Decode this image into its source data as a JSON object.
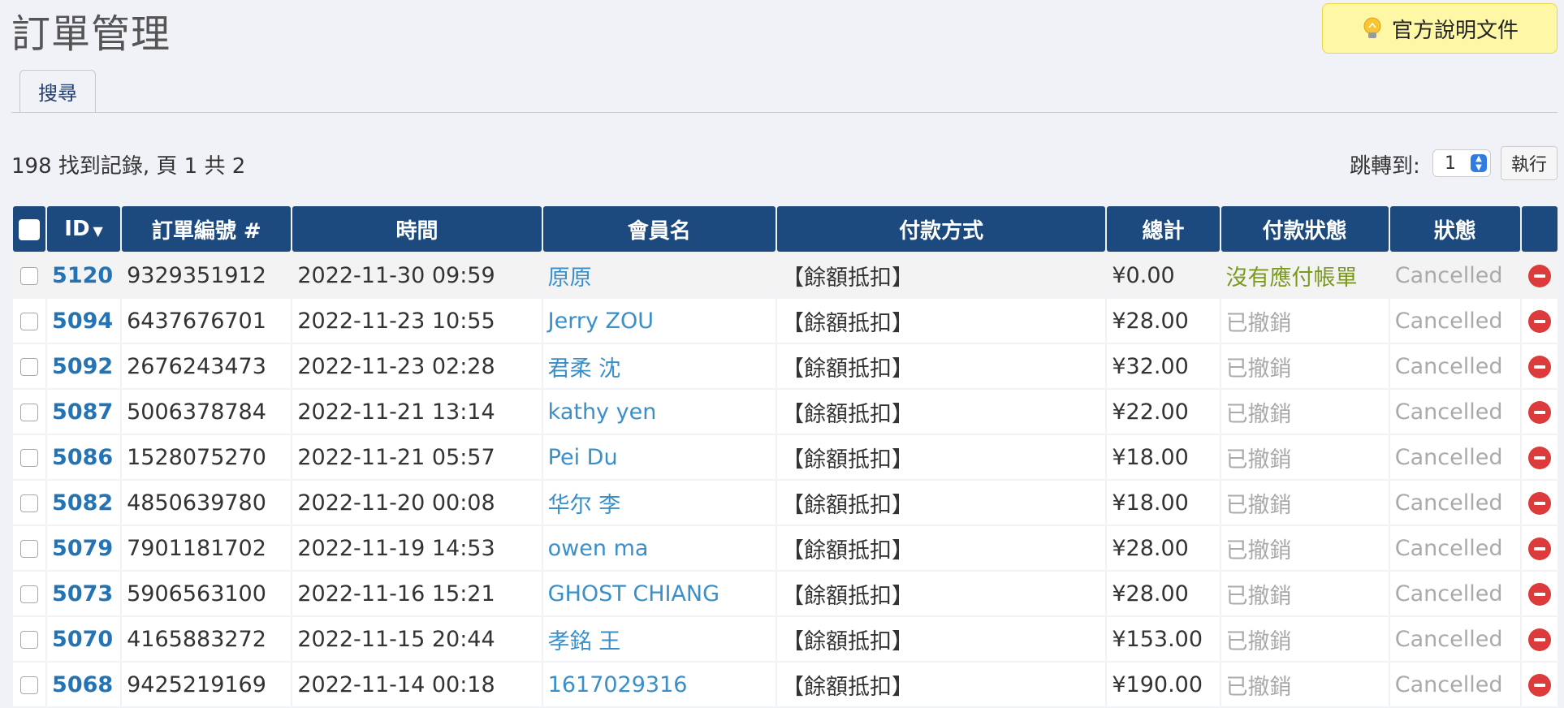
{
  "page": {
    "title": "訂單管理",
    "docs_button": "官方說明文件"
  },
  "tabs": [
    {
      "label": "搜尋"
    }
  ],
  "pagination": {
    "records_info": "198 找到記錄, 頁 1 共 2",
    "goto_label": "跳轉到:",
    "goto_value": "1",
    "goto_button": "執行"
  },
  "table": {
    "headers": {
      "id": "ID",
      "order_no": "訂單編號 #",
      "time": "時間",
      "member": "會員名",
      "payment": "付款方式",
      "total": "總計",
      "pay_status": "付款狀態",
      "status": "狀態"
    },
    "rows": [
      {
        "id": "5120",
        "order_no": "9329351912",
        "time": "2022-11-30 09:59",
        "member": "原原",
        "payment": "【餘額抵扣】",
        "total": "¥0.00",
        "pay_status": "沒有應付帳單",
        "status": "Cancelled"
      },
      {
        "id": "5094",
        "order_no": "6437676701",
        "time": "2022-11-23 10:55",
        "member": "Jerry ZOU",
        "payment": "【餘額抵扣】",
        "total": "¥28.00",
        "pay_status": "已撤銷",
        "status": "Cancelled"
      },
      {
        "id": "5092",
        "order_no": "2676243473",
        "time": "2022-11-23 02:28",
        "member": "君柔 沈",
        "payment": "【餘額抵扣】",
        "total": "¥32.00",
        "pay_status": "已撤銷",
        "status": "Cancelled"
      },
      {
        "id": "5087",
        "order_no": "5006378784",
        "time": "2022-11-21 13:14",
        "member": "kathy yen",
        "payment": "【餘額抵扣】",
        "total": "¥22.00",
        "pay_status": "已撤銷",
        "status": "Cancelled"
      },
      {
        "id": "5086",
        "order_no": "1528075270",
        "time": "2022-11-21 05:57",
        "member": "Pei Du",
        "payment": "【餘額抵扣】",
        "total": "¥18.00",
        "pay_status": "已撤銷",
        "status": "Cancelled"
      },
      {
        "id": "5082",
        "order_no": "4850639780",
        "time": "2022-11-20 00:08",
        "member": "华尔 李",
        "payment": "【餘額抵扣】",
        "total": "¥18.00",
        "pay_status": "已撤銷",
        "status": "Cancelled"
      },
      {
        "id": "5079",
        "order_no": "7901181702",
        "time": "2022-11-19 14:53",
        "member": "owen ma",
        "payment": "【餘額抵扣】",
        "total": "¥28.00",
        "pay_status": "已撤銷",
        "status": "Cancelled"
      },
      {
        "id": "5073",
        "order_no": "5906563100",
        "time": "2022-11-16 15:21",
        "member": "GHOST CHIANG",
        "payment": "【餘額抵扣】",
        "total": "¥28.00",
        "pay_status": "已撤銷",
        "status": "Cancelled"
      },
      {
        "id": "5070",
        "order_no": "4165883272",
        "time": "2022-11-15 20:44",
        "member": "孝銘 王",
        "payment": "【餘額抵扣】",
        "total": "¥153.00",
        "pay_status": "已撤銷",
        "status": "Cancelled"
      },
      {
        "id": "5068",
        "order_no": "9425219169",
        "time": "2022-11-14 00:18",
        "member": "1617029316",
        "payment": "【餘額抵扣】",
        "total": "¥190.00",
        "pay_status": "已撤銷",
        "status": "Cancelled"
      }
    ]
  },
  "colors": {
    "header_bg": "#1c4a7e",
    "link": "#2474b5",
    "member_link": "#3a8fc8",
    "muted": "#aaaaaa",
    "pay_status_special": "#7a9a1e",
    "delete": "#dd3b3b",
    "docs_bg": "#fdf7a6"
  },
  "icons": {
    "docs": "lightbulb-icon",
    "sort": "sort-desc-icon",
    "delete": "delete-icon",
    "select": "chevron-updown-icon"
  }
}
